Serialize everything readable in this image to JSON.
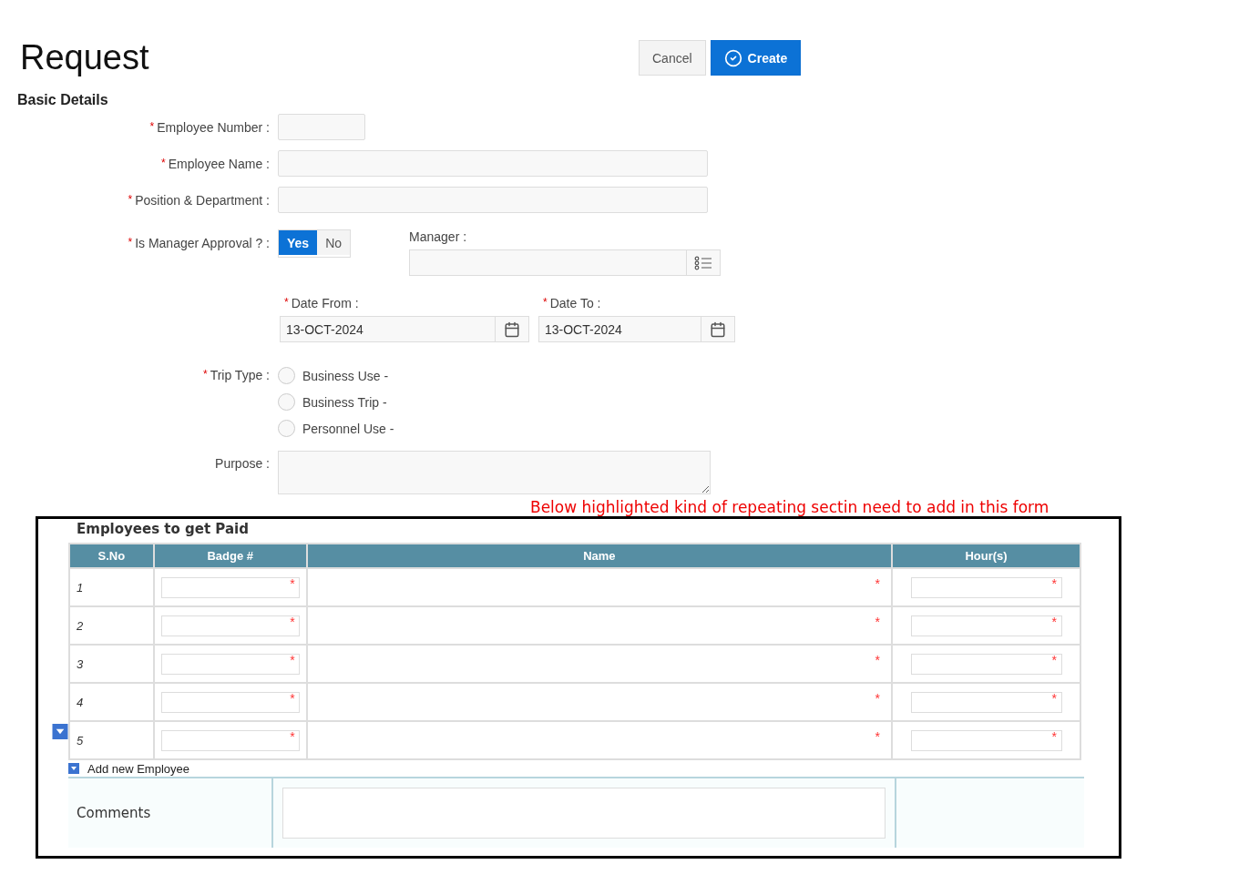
{
  "header": {
    "title": "Request",
    "buttons": [
      {
        "label": "Cancel",
        "kind": "secondary"
      },
      {
        "label": "Create",
        "kind": "primary"
      }
    ]
  },
  "basic_details": {
    "heading": "Basic Details",
    "text_fields": [
      {
        "label": "Employee Number :",
        "mark": "*",
        "kind": "short"
      },
      {
        "label": "Employee Name :",
        "mark": "*",
        "kind": "wide"
      },
      {
        "label": "Position & Department :",
        "mark": "*",
        "kind": "wide"
      }
    ],
    "approval": {
      "label": "Is Manager Approval ? :",
      "mark": "*",
      "options": [
        {
          "label": "Yes",
          "selected": true
        },
        {
          "label": "No",
          "selected": false
        }
      ]
    },
    "manager": {
      "label": "Manager :"
    },
    "dates": [
      {
        "label": "Date From :",
        "mark": "*",
        "value": "13-OCT-2024"
      },
      {
        "label": "Date To :",
        "mark": "*",
        "value": "13-OCT-2024"
      }
    ],
    "trip_type": {
      "label": "Trip Type :",
      "mark": "*",
      "options": [
        {
          "label": "Business Use -",
          "selected": false
        },
        {
          "label": "Business Trip -",
          "selected": false
        },
        {
          "label": "Personnel Use -",
          "selected": false
        }
      ]
    },
    "purpose": {
      "label": "Purpose :"
    }
  },
  "annotation": "Below highlighted kind of repeating sectin need to add in this form",
  "repeating_section": {
    "title": "Employees to get Paid",
    "columns": [
      "S.No",
      "Badge #",
      "Name",
      "Hour(s)"
    ],
    "rows": [
      {
        "sno": "1",
        "badge_mark": "*",
        "name_mark": "*",
        "hours_mark": "*"
      },
      {
        "sno": "2",
        "badge_mark": "*",
        "name_mark": "*",
        "hours_mark": "*"
      },
      {
        "sno": "3",
        "badge_mark": "*",
        "name_mark": "*",
        "hours_mark": "*"
      },
      {
        "sno": "4",
        "badge_mark": "*",
        "name_mark": "*",
        "hours_mark": "*"
      },
      {
        "sno": "5",
        "badge_mark": "*",
        "name_mark": "*",
        "hours_mark": "*"
      }
    ],
    "add_link": "Add new Employee",
    "comments_label": "Comments"
  }
}
